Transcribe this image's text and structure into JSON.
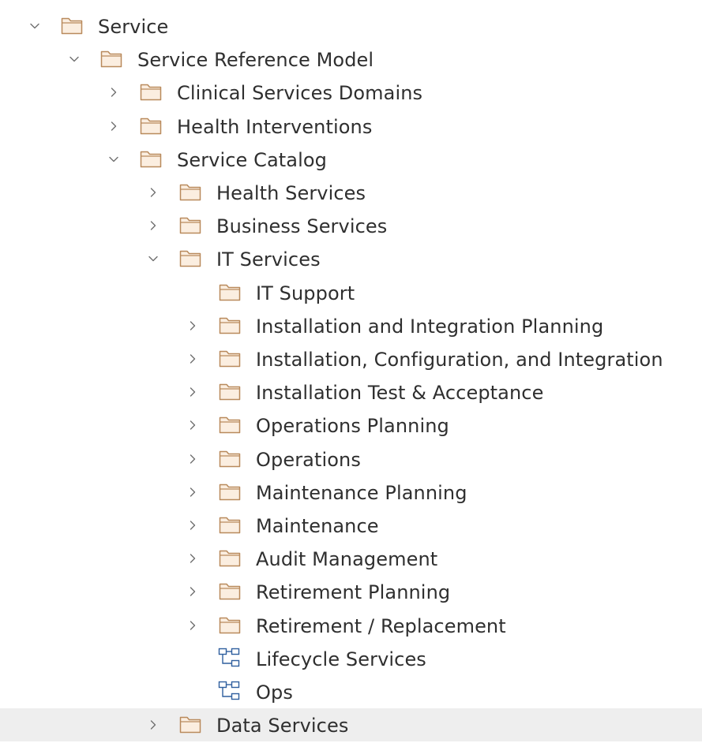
{
  "tree": {
    "nodes": [
      {
        "id": "service",
        "label": "Service",
        "level": 0,
        "expander": "expanded",
        "icon": "folder-icon"
      },
      {
        "id": "service-reference-model",
        "label": "Service Reference Model",
        "level": 1,
        "expander": "expanded",
        "icon": "folder-icon"
      },
      {
        "id": "clinical-services-domains",
        "label": "Clinical Services Domains",
        "level": 2,
        "expander": "collapsed",
        "icon": "folder-icon"
      },
      {
        "id": "health-interventions",
        "label": "Health Interventions",
        "level": 2,
        "expander": "collapsed",
        "icon": "folder-icon"
      },
      {
        "id": "service-catalog",
        "label": "Service Catalog",
        "level": 2,
        "expander": "expanded",
        "icon": "folder-icon"
      },
      {
        "id": "health-services",
        "label": "Health Services",
        "level": 3,
        "expander": "collapsed",
        "icon": "folder-icon"
      },
      {
        "id": "business-services",
        "label": "Business Services",
        "level": 3,
        "expander": "collapsed",
        "icon": "folder-icon"
      },
      {
        "id": "it-services",
        "label": "IT Services",
        "level": 3,
        "expander": "expanded",
        "icon": "folder-icon"
      },
      {
        "id": "it-support",
        "label": "IT Support",
        "level": 4,
        "expander": "none",
        "icon": "folder-icon"
      },
      {
        "id": "installation-and-integration-planning",
        "label": "Installation and Integration Planning",
        "level": 4,
        "expander": "collapsed",
        "icon": "folder-icon"
      },
      {
        "id": "installation-configuration-integration",
        "label": "Installation, Configuration, and Integration",
        "level": 4,
        "expander": "collapsed",
        "icon": "folder-icon"
      },
      {
        "id": "installation-test-acceptance",
        "label": "Installation Test & Acceptance",
        "level": 4,
        "expander": "collapsed",
        "icon": "folder-icon"
      },
      {
        "id": "operations-planning",
        "label": "Operations Planning",
        "level": 4,
        "expander": "collapsed",
        "icon": "folder-icon"
      },
      {
        "id": "operations",
        "label": "Operations",
        "level": 4,
        "expander": "collapsed",
        "icon": "folder-icon"
      },
      {
        "id": "maintenance-planning",
        "label": "Maintenance Planning",
        "level": 4,
        "expander": "collapsed",
        "icon": "folder-icon"
      },
      {
        "id": "maintenance",
        "label": "Maintenance",
        "level": 4,
        "expander": "collapsed",
        "icon": "folder-icon"
      },
      {
        "id": "audit-management",
        "label": "Audit Management",
        "level": 4,
        "expander": "collapsed",
        "icon": "folder-icon"
      },
      {
        "id": "retirement-planning",
        "label": "Retirement Planning",
        "level": 4,
        "expander": "collapsed",
        "icon": "folder-icon"
      },
      {
        "id": "retirement-replacement",
        "label": "Retirement / Replacement",
        "level": 4,
        "expander": "collapsed",
        "icon": "folder-icon"
      },
      {
        "id": "lifecycle-services",
        "label": "Lifecycle Services",
        "level": 4,
        "expander": "none",
        "icon": "diagram-icon"
      },
      {
        "id": "ops",
        "label": "Ops",
        "level": 4,
        "expander": "none",
        "icon": "diagram-icon"
      },
      {
        "id": "data-services",
        "label": "Data Services",
        "level": 3,
        "expander": "collapsed",
        "icon": "folder-icon",
        "selected": true
      }
    ]
  },
  "colors": {
    "folder_fill": "#fbeee0",
    "folder_stroke": "#b98a5c",
    "diagram_stroke": "#2f5f9e",
    "chevron": "#6f6f6f",
    "text": "#2f2f2f",
    "selected_row": "#eeeeee"
  }
}
